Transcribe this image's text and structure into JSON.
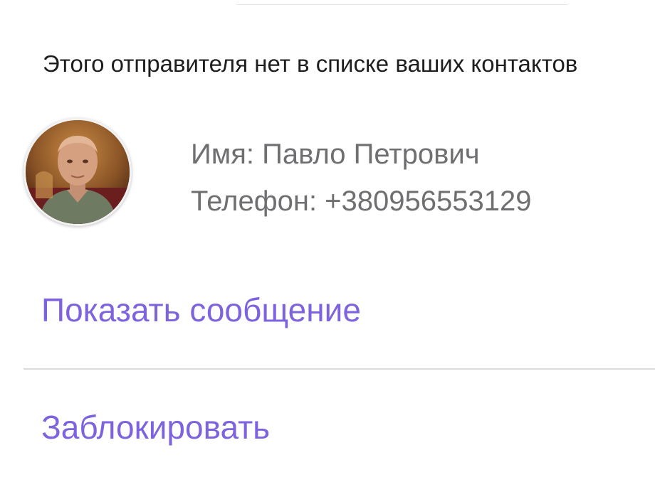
{
  "notice": {
    "text": "Этого отправителя нет в списке ваших контактов"
  },
  "sender": {
    "name_line": "Имя: Павло Петрович",
    "phone_line": "Телефон: +380956553129"
  },
  "actions": {
    "show_message": "Показать сообщение",
    "block": "Заблокировать"
  },
  "colors": {
    "accent": "#7e63df",
    "secondary_text": "#6f6f72",
    "primary_text": "#1e1e1e",
    "divider": "#dcdcdc"
  }
}
